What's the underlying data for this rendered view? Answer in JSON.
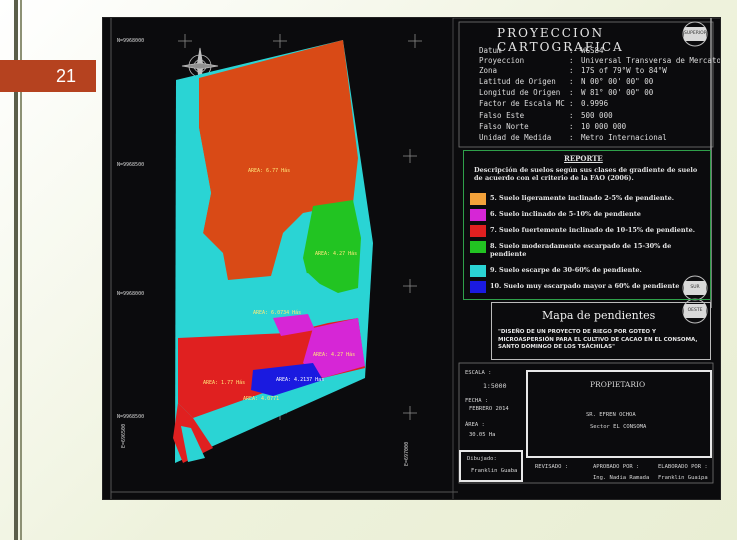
{
  "slide": {
    "number": "21"
  },
  "map": {
    "grid_labels": [
      "N=9968000",
      "N=9968500",
      "N=9968000",
      "N=9968500"
    ],
    "side_labels": [
      "E=696500",
      "E=697000"
    ],
    "area_labels": [
      "AREA: 6.77 Hás",
      "AREA: 4.27 Hás",
      "AREA: 6.0734 Hás",
      "AREA: 4.27 Hás",
      "AREA: 1.77 Hás",
      "AREA: 4.2137 Has",
      "AREA: 4.0771"
    ]
  },
  "projection": {
    "title": "PROYECCION CARTOGRAFICA",
    "rows": [
      {
        "label": "Datum",
        "value": "WGS84"
      },
      {
        "label": "Proyeccion",
        "value": "Universal Transversa de Mercator"
      },
      {
        "label": "Zona",
        "value": "17S of 79°W to 84°W"
      },
      {
        "label": "Latitud de Origen",
        "value": "N 00° 00' 00\" 00"
      },
      {
        "label": "Longitud de Origen",
        "value": "W 81° 00' 00\" 00"
      },
      {
        "label": "Factor de Escala MC",
        "value": "0.9996"
      },
      {
        "label": "Falso Este",
        "value": "500 000"
      },
      {
        "label": "Falso Norte",
        "value": "10 000 000"
      },
      {
        "label": "Unidad de Medida",
        "value": "Metro Internacional"
      }
    ]
  },
  "report": {
    "title": "REPORTE",
    "description": "Descripción de suelos según sus clases de gradiente de suelo de acuerdo con el criterio de la FAO (2006).",
    "legend": [
      {
        "text": "5. Suelo ligeramente inclinado 2-5% de pendiente.",
        "color": "#f4a23a"
      },
      {
        "text": "6. Suelo inclinado de 5-10% de pendiente",
        "color": "#d626d6"
      },
      {
        "text": "7. Suelo fuertemente inclinado de 10-15% de pendiente.",
        "color": "#e02020"
      },
      {
        "text": "8. Suelo moderadamente escarpado de 15-30% de pendiente",
        "color": "#22c422"
      },
      {
        "text": "9. Suelo escarpe de 30-60% de pendiente.",
        "color": "#2ad4d4"
      },
      {
        "text": "10. Suelo muy escarpado mayor a 60% de pendiente",
        "color": "#1a1ae0"
      }
    ]
  },
  "title_block": {
    "title": "Mapa de pendientes",
    "subtitle": "\"DISEÑO DE UN PROYECTO DE RIEGO POR GOTEO Y MICROASPERSIÓN PARA EL CULTIVO DE CACAO EN EL CONSOMA, SANTO DOMINGO DE LOS TSÁCHILAS\"",
    "escala_label": "ESCALA :",
    "escala_value": "1:5000",
    "fecha_label": "FECHA :",
    "fecha_value": "FEBRERO 2014",
    "area_label": "ÁREA :",
    "area_value": "30.05 Ha",
    "propietario_label": "PROPIETARIO",
    "propietario_name": "SR. EFREN OCHOA",
    "propietario_sector": "Sector EL CONSOMA",
    "dibujado_label": "Dibujado:",
    "dibujado_name": "Franklin Guaba",
    "revisado_label": "REVISADO :",
    "aprobado_label": "APROBADO POR :",
    "aprobado_name": "Ing. Nadia Ramada",
    "elaborado_label": "ELABORADO POR :",
    "elaborado_name": "Franklin Guaipa"
  },
  "north_arrow": {
    "letters": [
      "N",
      "S",
      "E",
      "O"
    ]
  },
  "view_buttons": [
    "SUPERIOR",
    "SUR",
    "OESTE"
  ]
}
